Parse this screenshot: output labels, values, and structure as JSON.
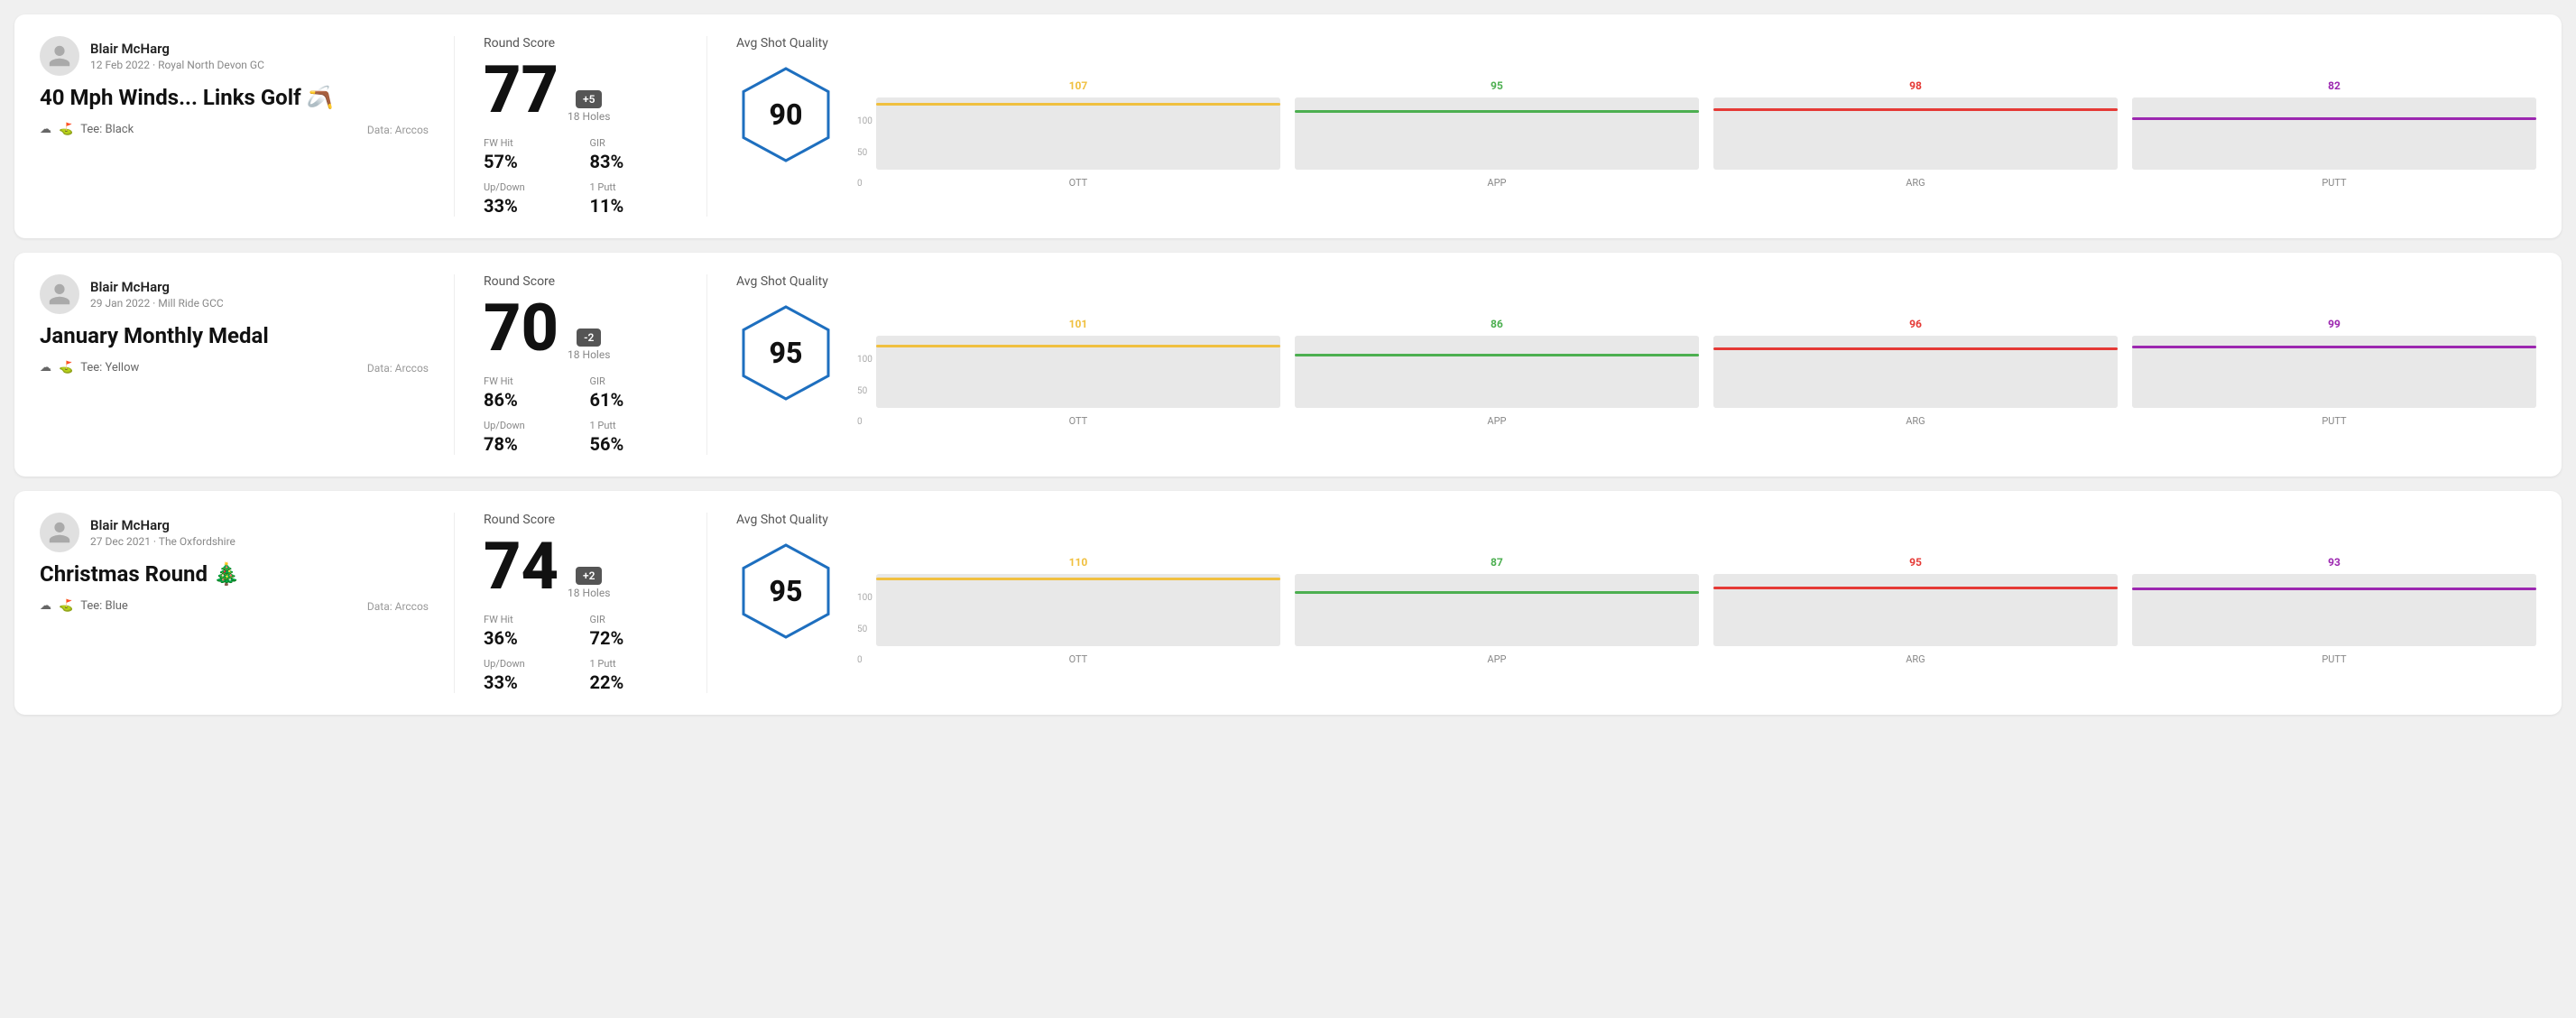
{
  "rounds": [
    {
      "id": "round-1",
      "user": {
        "name": "Blair McHarg",
        "meta": "12 Feb 2022 · Royal North Devon GC"
      },
      "title": "40 Mph Winds... Links Golf 🪃",
      "tee": "Black",
      "data_source": "Data: Arccos",
      "score": "77",
      "badge": "+5",
      "holes": "18 Holes",
      "fw_hit": "57%",
      "gir": "83%",
      "up_down": "33%",
      "one_putt": "11%",
      "avg_quality": "90",
      "chart": {
        "ott": {
          "value": 107,
          "color": "#f0c040",
          "pct": 78
        },
        "app": {
          "value": 95,
          "color": "#4caf50",
          "pct": 70
        },
        "arg": {
          "value": 98,
          "color": "#e53935",
          "pct": 72
        },
        "putt": {
          "value": 82,
          "color": "#9c27b0",
          "pct": 60
        }
      }
    },
    {
      "id": "round-2",
      "user": {
        "name": "Blair McHarg",
        "meta": "29 Jan 2022 · Mill Ride GCC"
      },
      "title": "January Monthly Medal",
      "tee": "Yellow",
      "data_source": "Data: Arccos",
      "score": "70",
      "badge": "-2",
      "holes": "18 Holes",
      "fw_hit": "86%",
      "gir": "61%",
      "up_down": "78%",
      "one_putt": "56%",
      "avg_quality": "95",
      "chart": {
        "ott": {
          "value": 101,
          "color": "#f0c040",
          "pct": 75
        },
        "app": {
          "value": 86,
          "color": "#4caf50",
          "pct": 64
        },
        "arg": {
          "value": 96,
          "color": "#e53935",
          "pct": 71
        },
        "putt": {
          "value": 99,
          "color": "#9c27b0",
          "pct": 73
        }
      }
    },
    {
      "id": "round-3",
      "user": {
        "name": "Blair McHarg",
        "meta": "27 Dec 2021 · The Oxfordshire"
      },
      "title": "Christmas Round 🎄",
      "tee": "Blue",
      "data_source": "Data: Arccos",
      "score": "74",
      "badge": "+2",
      "holes": "18 Holes",
      "fw_hit": "36%",
      "gir": "72%",
      "up_down": "33%",
      "one_putt": "22%",
      "avg_quality": "95",
      "chart": {
        "ott": {
          "value": 110,
          "color": "#f0c040",
          "pct": 82
        },
        "app": {
          "value": 87,
          "color": "#4caf50",
          "pct": 65
        },
        "arg": {
          "value": 95,
          "color": "#e53935",
          "pct": 70
        },
        "putt": {
          "value": 93,
          "color": "#9c27b0",
          "pct": 69
        }
      }
    }
  ],
  "labels": {
    "round_score": "Round Score",
    "fw_hit": "FW Hit",
    "gir": "GIR",
    "up_down": "Up/Down",
    "one_putt": "1 Putt",
    "avg_shot_quality": "Avg Shot Quality",
    "ott": "OTT",
    "app": "APP",
    "arg": "ARG",
    "putt": "PUTT",
    "tee_prefix": "Tee:",
    "y_100": "100",
    "y_50": "50",
    "y_0": "0"
  }
}
